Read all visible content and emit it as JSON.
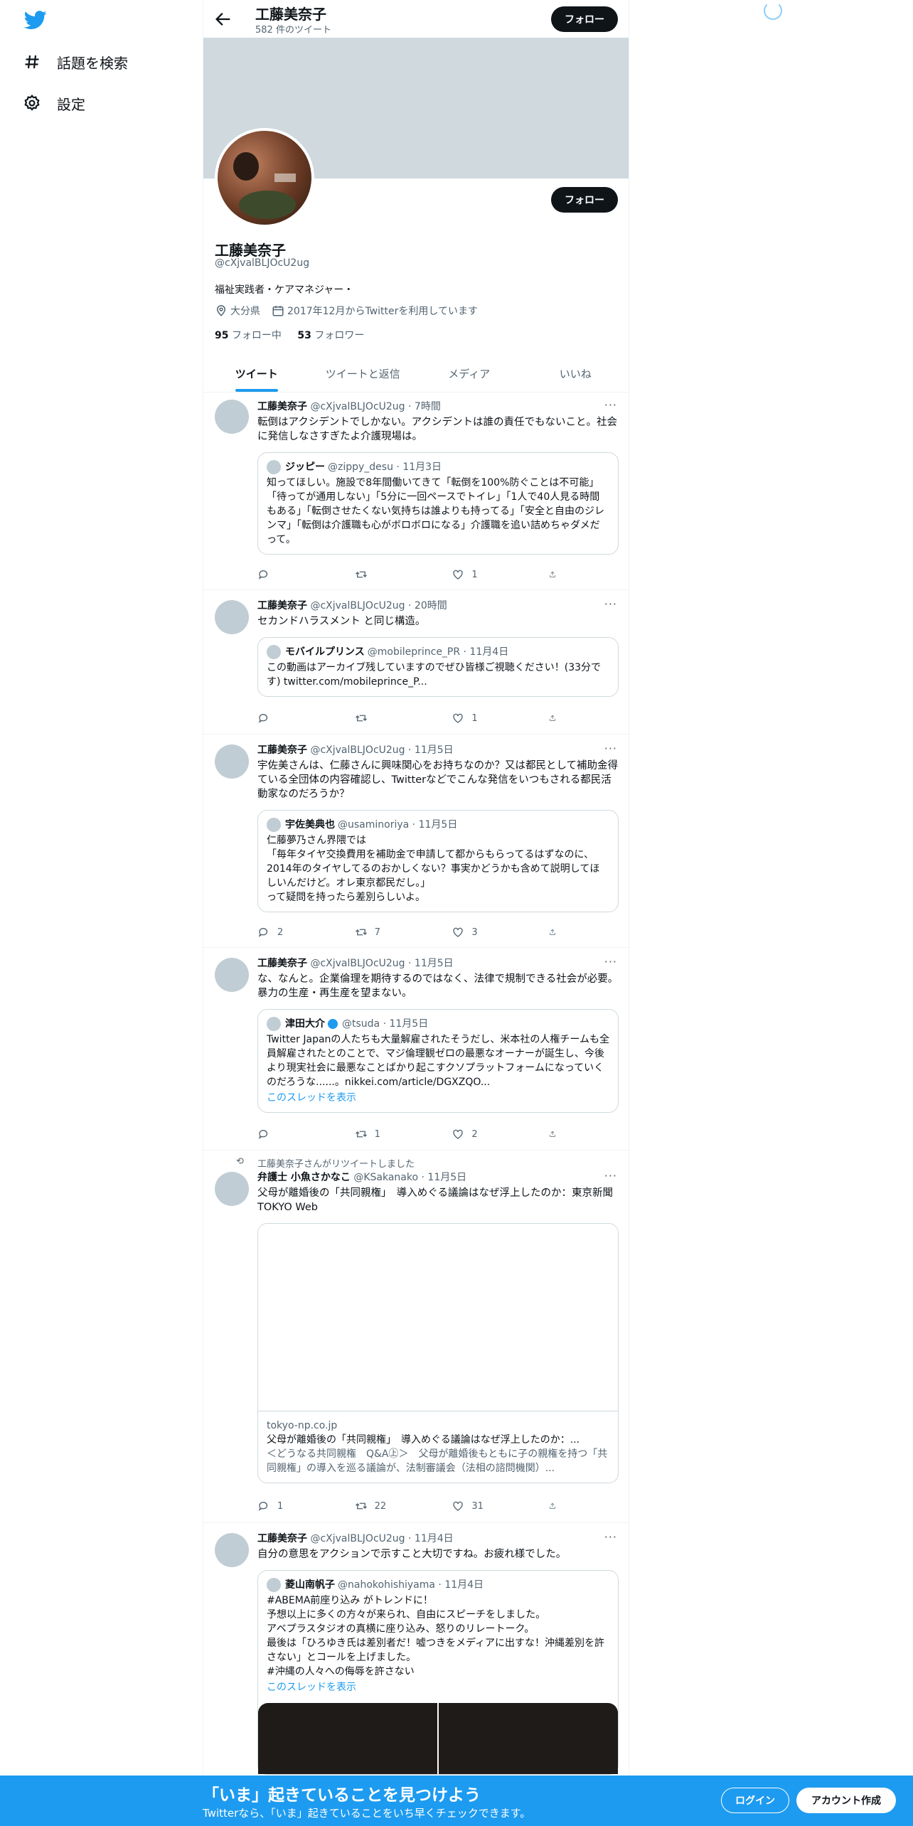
{
  "nav": {
    "items": [
      {
        "label": "話題を検索",
        "icon": "hashtag-icon"
      },
      {
        "label": "設定",
        "icon": "gear-icon"
      }
    ]
  },
  "header": {
    "name": "工藤美奈子",
    "count": "582 件のツイート",
    "follow": "フォロー"
  },
  "profile": {
    "name": "工藤美奈子",
    "handle": "@cXjvalBLJOcU2ug",
    "bio": "福祉実践者・ケアマネジャー・",
    "location": "大分県",
    "joined": "2017年12月からTwitterを利用しています",
    "following_count": "95",
    "following_label": "フォロー中",
    "followers_count": "53",
    "followers_label": "フォロワー",
    "follow": "フォロー"
  },
  "tabs": [
    "ツイート",
    "ツイートと返信",
    "メディア",
    "いいね"
  ],
  "tweets": [
    {
      "name": "工藤美奈子",
      "handle": "@cXjvalBLJOcU2ug",
      "time": "7時間",
      "text": "転倒はアクシデントでしかない。アクシデントは誰の責任でもないこと。社会に発信しなさすぎたよ介護現場は。",
      "quote": {
        "name": "ジッピー",
        "handle": "@zippy_desu",
        "time": "11月3日",
        "text": "知ってほしい。施設で8年間働いてきて「転倒を100%防ぐことは不可能」「待ってが通用しない」「5分に一回ペースでトイレ」「1人で40人見る時間もある」「転倒させたくない気持ちは誰よりも持ってる」「安全と自由のジレンマ」「転倒は介護職も心がボロボロになる」介護職を追い詰めちゃダメだって。"
      },
      "reply": "",
      "retweet": "",
      "like": "1"
    },
    {
      "name": "工藤美奈子",
      "handle": "@cXjvalBLJOcU2ug",
      "time": "20時間",
      "text": "セカンドハラスメント と同じ構造。",
      "quote": {
        "name": "モバイルプリンス",
        "handle": "@mobileprince_PR",
        "time": "11月4日",
        "text": "この動画はアーカイブ残していますのでぜひ皆様ご視聴ください！(33分です) twitter.com/mobileprince_P..."
      },
      "reply": "",
      "retweet": "",
      "like": "1"
    },
    {
      "name": "工藤美奈子",
      "handle": "@cXjvalBLJOcU2ug",
      "time": "11月5日",
      "text": "宇佐美さんは、仁藤さんに興味関心をお持ちなのか？又は都民として補助金得ている全団体の内容確認し、Twitterなどでこんな発信をいつもされる都民活動家なのだろうか？",
      "quote": {
        "name": "宇佐美典也",
        "handle": "@usaminoriya",
        "time": "11月5日",
        "text": "仁藤夢乃さん界隈では\n「毎年タイヤ交換費用を補助金で申請して都からもらってるはずなのに、2014年のタイヤしてるのおかしくない？事実かどうかも含めて説明してほしいんだけど。オレ東京都民だし。」\nって疑問を持ったら差別らしいよ。"
      },
      "reply": "2",
      "retweet": "7",
      "like": "3"
    },
    {
      "name": "工藤美奈子",
      "handle": "@cXjvalBLJOcU2ug",
      "time": "11月5日",
      "text": "な、なんと。企業倫理を期待するのではなく、法律で規制できる社会が必要。暴力の生産・再生産を望まない。",
      "quote": {
        "name": "津田大介",
        "handle": "@tsuda",
        "time": "11月5日",
        "text": "Twitter Japanの人たちも大量解雇されたそうだし、米本社の人権チームも全員解雇されたとのことで、マジ倫理観ゼロの最悪なオーナーが誕生し、今後より現実社会に最悪なことばかり起こすクソプラットフォームになっていくのだろうな......。nikkei.com/article/DGXZQO...",
        "thread": "このスレッドを表示"
      },
      "reply": "",
      "retweet": "1",
      "like": "2"
    },
    {
      "rt_label": "工藤美奈子さんがリツイートしました",
      "name": "弁護士 小魚さかなこ",
      "handle": "@KSakanako",
      "time": "11月5日",
      "text": "父母が離婚後の「共同親権」　導入めぐる議論はなぜ浮上したのか：東京新聞 TOKYO Web",
      "card": {
        "domain": "tokyo-np.co.jp",
        "title": "父母が離婚後の「共同親権」　導入めぐる議論はなぜ浮上したのか：...",
        "desc": "＜どうなる共同親権　Q&A㊤＞　父母が離婚後もともに子の親権を持つ「共同親権」の導入を巡る議論が、法制審議会（法相の諮問機関）..."
      },
      "reply": "1",
      "retweet": "22",
      "like": "31"
    },
    {
      "name": "工藤美奈子",
      "handle": "@cXjvalBLJOcU2ug",
      "time": "11月4日",
      "text": "自分の意思をアクションで示すこと大切ですね。お疲れ様でした。",
      "quote": {
        "name": "菱山南帆子",
        "handle": "@nahokohishiyama",
        "time": "11月4日",
        "text": "#ABEMA前座り込み がトレンドに！\n予想以上に多くの方々が来られ、自由にスピーチをしました。\nアベプラスタジオの真横に座り込み、怒りのリレートーク。\n最後は「ひろゆき氏は差別者だ！嘘つきをメディアに出すな！沖縄差別を許さない」とコールを上げました。\n#沖縄の人々への侮辱を許さない",
        "thread": "このスレッドを表示"
      }
    }
  ],
  "bottom": {
    "title": "「いま」起きていることを見つけよう",
    "sub": "Twitterなら、「いま」起きていることをいち早くチェックできます。",
    "login": "ログイン",
    "signup": "アカウント作成"
  }
}
